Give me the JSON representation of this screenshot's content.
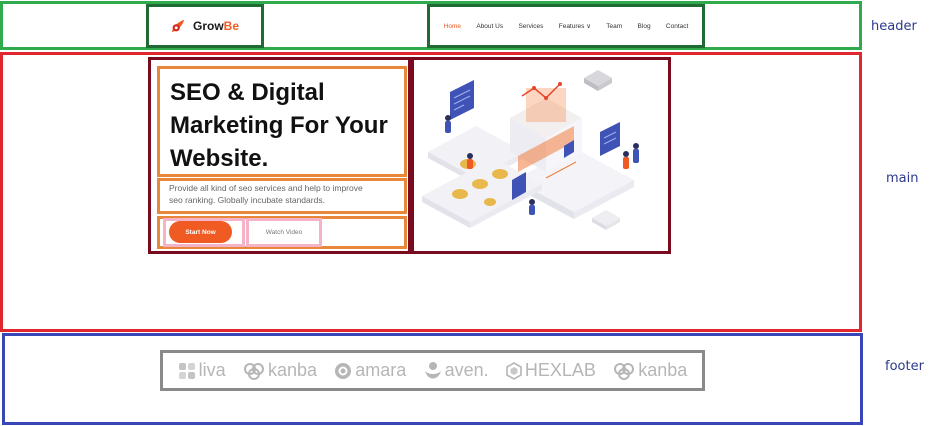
{
  "regions": {
    "header": "header",
    "main": "main",
    "footer": "footer"
  },
  "brand": {
    "name_main": "Grow",
    "name_accent": "Be"
  },
  "nav": {
    "items": [
      {
        "label": "Home",
        "active": true
      },
      {
        "label": "About Us",
        "active": false
      },
      {
        "label": "Services",
        "active": false
      },
      {
        "label": "Features ∨",
        "active": false
      },
      {
        "label": "Team",
        "active": false
      },
      {
        "label": "Blog",
        "active": false
      },
      {
        "label": "Contact",
        "active": false
      }
    ]
  },
  "hero": {
    "title_line1": "SEO & Digital",
    "title_line2": "Marketing For Your",
    "title_line3": "Website.",
    "desc_line1": "Provide all kind of seo services and help to improve",
    "desc_line2": "seo ranking. Globally incubate standards.",
    "primary_cta": "Start Now",
    "secondary_cta": "Watch Video"
  },
  "partners": [
    "liva",
    "kanba",
    "amara",
    "aven.",
    "HEXLAB",
    "kanba"
  ],
  "colors": {
    "accent": "#f05a23",
    "header_frame": "#2faa4c",
    "main_frame": "#e0262f",
    "footer_frame": "#3946b8"
  }
}
